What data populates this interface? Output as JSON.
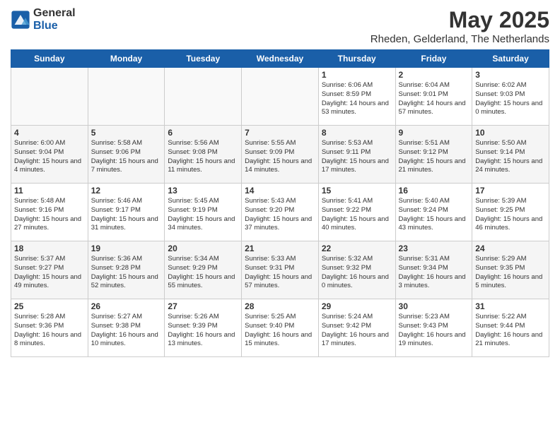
{
  "logo": {
    "general": "General",
    "blue": "Blue"
  },
  "title": "May 2025",
  "location": "Rheden, Gelderland, The Netherlands",
  "days_of_week": [
    "Sunday",
    "Monday",
    "Tuesday",
    "Wednesday",
    "Thursday",
    "Friday",
    "Saturday"
  ],
  "weeks": [
    [
      {
        "day": "",
        "empty": true
      },
      {
        "day": "",
        "empty": true
      },
      {
        "day": "",
        "empty": true
      },
      {
        "day": "",
        "empty": true
      },
      {
        "day": "1",
        "sunrise": "6:06 AM",
        "sunset": "8:59 PM",
        "daylight": "14 hours and 53 minutes."
      },
      {
        "day": "2",
        "sunrise": "6:04 AM",
        "sunset": "9:01 PM",
        "daylight": "14 hours and 57 minutes."
      },
      {
        "day": "3",
        "sunrise": "6:02 AM",
        "sunset": "9:03 PM",
        "daylight": "15 hours and 0 minutes."
      }
    ],
    [
      {
        "day": "4",
        "sunrise": "6:00 AM",
        "sunset": "9:04 PM",
        "daylight": "15 hours and 4 minutes."
      },
      {
        "day": "5",
        "sunrise": "5:58 AM",
        "sunset": "9:06 PM",
        "daylight": "15 hours and 7 minutes."
      },
      {
        "day": "6",
        "sunrise": "5:56 AM",
        "sunset": "9:08 PM",
        "daylight": "15 hours and 11 minutes."
      },
      {
        "day": "7",
        "sunrise": "5:55 AM",
        "sunset": "9:09 PM",
        "daylight": "15 hours and 14 minutes."
      },
      {
        "day": "8",
        "sunrise": "5:53 AM",
        "sunset": "9:11 PM",
        "daylight": "15 hours and 17 minutes."
      },
      {
        "day": "9",
        "sunrise": "5:51 AM",
        "sunset": "9:12 PM",
        "daylight": "15 hours and 21 minutes."
      },
      {
        "day": "10",
        "sunrise": "5:50 AM",
        "sunset": "9:14 PM",
        "daylight": "15 hours and 24 minutes."
      }
    ],
    [
      {
        "day": "11",
        "sunrise": "5:48 AM",
        "sunset": "9:16 PM",
        "daylight": "15 hours and 27 minutes."
      },
      {
        "day": "12",
        "sunrise": "5:46 AM",
        "sunset": "9:17 PM",
        "daylight": "15 hours and 31 minutes."
      },
      {
        "day": "13",
        "sunrise": "5:45 AM",
        "sunset": "9:19 PM",
        "daylight": "15 hours and 34 minutes."
      },
      {
        "day": "14",
        "sunrise": "5:43 AM",
        "sunset": "9:20 PM",
        "daylight": "15 hours and 37 minutes."
      },
      {
        "day": "15",
        "sunrise": "5:41 AM",
        "sunset": "9:22 PM",
        "daylight": "15 hours and 40 minutes."
      },
      {
        "day": "16",
        "sunrise": "5:40 AM",
        "sunset": "9:24 PM",
        "daylight": "15 hours and 43 minutes."
      },
      {
        "day": "17",
        "sunrise": "5:39 AM",
        "sunset": "9:25 PM",
        "daylight": "15 hours and 46 minutes."
      }
    ],
    [
      {
        "day": "18",
        "sunrise": "5:37 AM",
        "sunset": "9:27 PM",
        "daylight": "15 hours and 49 minutes."
      },
      {
        "day": "19",
        "sunrise": "5:36 AM",
        "sunset": "9:28 PM",
        "daylight": "15 hours and 52 minutes."
      },
      {
        "day": "20",
        "sunrise": "5:34 AM",
        "sunset": "9:29 PM",
        "daylight": "15 hours and 55 minutes."
      },
      {
        "day": "21",
        "sunrise": "5:33 AM",
        "sunset": "9:31 PM",
        "daylight": "15 hours and 57 minutes."
      },
      {
        "day": "22",
        "sunrise": "5:32 AM",
        "sunset": "9:32 PM",
        "daylight": "16 hours and 0 minutes."
      },
      {
        "day": "23",
        "sunrise": "5:31 AM",
        "sunset": "9:34 PM",
        "daylight": "16 hours and 3 minutes."
      },
      {
        "day": "24",
        "sunrise": "5:29 AM",
        "sunset": "9:35 PM",
        "daylight": "16 hours and 5 minutes."
      }
    ],
    [
      {
        "day": "25",
        "sunrise": "5:28 AM",
        "sunset": "9:36 PM",
        "daylight": "16 hours and 8 minutes."
      },
      {
        "day": "26",
        "sunrise": "5:27 AM",
        "sunset": "9:38 PM",
        "daylight": "16 hours and 10 minutes."
      },
      {
        "day": "27",
        "sunrise": "5:26 AM",
        "sunset": "9:39 PM",
        "daylight": "16 hours and 13 minutes."
      },
      {
        "day": "28",
        "sunrise": "5:25 AM",
        "sunset": "9:40 PM",
        "daylight": "16 hours and 15 minutes."
      },
      {
        "day": "29",
        "sunrise": "5:24 AM",
        "sunset": "9:42 PM",
        "daylight": "16 hours and 17 minutes."
      },
      {
        "day": "30",
        "sunrise": "5:23 AM",
        "sunset": "9:43 PM",
        "daylight": "16 hours and 19 minutes."
      },
      {
        "day": "31",
        "sunrise": "5:22 AM",
        "sunset": "9:44 PM",
        "daylight": "16 hours and 21 minutes."
      }
    ]
  ]
}
